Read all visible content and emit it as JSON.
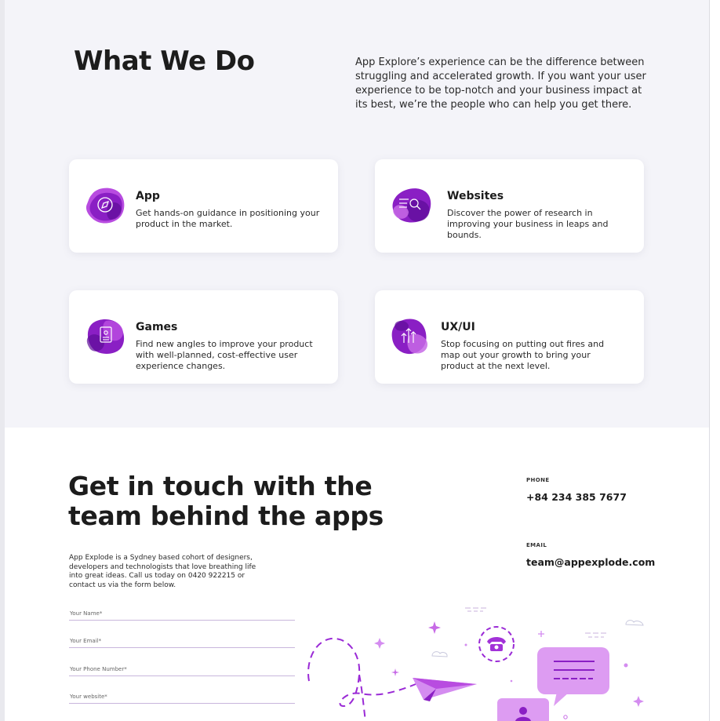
{
  "what_we_do": {
    "title": "What We Do",
    "intro": "App Explore’s experience can be the difference between struggling and accelerated growth. If you want your user experience to be top-notch and your business impact at its best, we’re the people who can help you get there.",
    "services": [
      {
        "title": "App",
        "description": "Get hands-on guidance in positioning your product in the market.",
        "icon": "compass-icon"
      },
      {
        "title": "Websites",
        "description": "Discover the power of research in improving your business in leaps and bounds.",
        "icon": "search-list-icon"
      },
      {
        "title": "Games",
        "description": "Find new angles to improve your product with well-planned, cost-effective user experience changes.",
        "icon": "document-icon"
      },
      {
        "title": "UX/UI",
        "description": "Stop focusing on putting out fires and map out your growth to bring your product at the next level.",
        "icon": "arrows-up-icon"
      }
    ]
  },
  "contact": {
    "title_line1": "Get in touch with the",
    "title_line2": "team behind the apps",
    "intro": "App Explode is a Sydney based cohort of designers, developers and technologists that love breathing life into great ideas. Call us today on 0420 922215 or contact us via the form below.",
    "phone_label": "PHONE",
    "phone": "+84 234 385 7677",
    "email_label": "EMAIL",
    "email": "team@appexplode.com",
    "form": {
      "name_placeholder": "Your Name*",
      "email_placeholder": "Your Email*",
      "phone_placeholder": "Your Phone Number*",
      "website_placeholder": "Your website*"
    }
  },
  "colors": {
    "accent_purple": "#8a1fc4",
    "accent_light": "#e3a8f0",
    "section_bg": "#f4f4f9"
  }
}
